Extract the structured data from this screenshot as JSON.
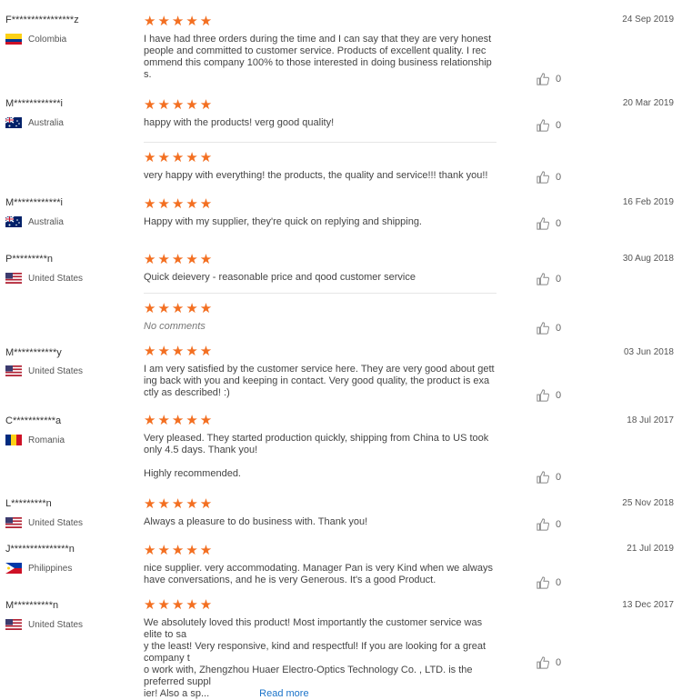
{
  "colors": {
    "star": "#f36f21",
    "link": "#1a73c9"
  },
  "stars_icon": "★★★★★",
  "reviews": [
    {
      "name": "F****************z",
      "country": "Colombia",
      "flag": "colombia",
      "date": "24 Sep 2019",
      "entries": [
        {
          "text": "I have had three orders during the time and I can say that they are very honest\npeople and committed to customer service. Products of excellent quality. I rec\nommend this company 100% to those interested in doing business relationship\ns.",
          "likes": "0"
        }
      ]
    },
    {
      "name": "M************i",
      "country": "Australia",
      "flag": "australia",
      "date": "20 Mar 2019",
      "entries": [
        {
          "text": "happy with the products! verg good quality!",
          "likes": "0"
        },
        {
          "text": "very happy with everything! the products, the quality and service!!! thank you!!",
          "likes": "0"
        }
      ]
    },
    {
      "name": "M************i",
      "country": "Australia",
      "flag": "australia",
      "date": "16 Feb 2019",
      "entries": [
        {
          "text": "Happy with my supplier, they're quick on replying and shipping.",
          "likes": "0"
        }
      ]
    },
    {
      "name": "P*********n",
      "country": "United States",
      "flag": "us",
      "date": "30 Aug 2018",
      "entries": [
        {
          "text": "Quick deievery - reasonable price and qood customer service",
          "likes": "0"
        },
        {
          "text": "No comments",
          "likes": "0"
        }
      ]
    },
    {
      "name": "M***********y",
      "country": "United States",
      "flag": "us",
      "date": "03 Jun 2018",
      "entries": [
        {
          "text": "I am very satisfied by the customer service here. They are very good about gett\ning back with you and keeping in contact. Very good quality, the product is exa\nctly as described! :)",
          "likes": "0"
        }
      ]
    },
    {
      "name": "C***********a",
      "country": "Romania",
      "flag": "romania",
      "date": "18 Jul 2017",
      "entries": [
        {
          "text": "Very pleased. They started production quickly, shipping from China to US took\nonly 4.5 days. Thank you!\n\nHighly recommended.",
          "likes": "0"
        }
      ]
    },
    {
      "name": "L*********n",
      "country": "United States",
      "flag": "us",
      "date": "25 Nov 2018",
      "entries": [
        {
          "text": "Always a pleasure to do business with. Thank you!",
          "likes": "0"
        }
      ]
    },
    {
      "name": "J***************n",
      "country": "Philippines",
      "flag": "philippines",
      "date": "21 Jul 2019",
      "entries": [
        {
          "text": "nice supplier. very accommodating. Manager Pan is very Kind when we always\nhave conversations, and he is very Generous. It's a good Product.",
          "likes": "0"
        }
      ]
    },
    {
      "name": "M**********n",
      "country": "United States",
      "flag": "us",
      "date": "13 Dec 2017",
      "entries": [
        {
          "text": "We absolutely loved this product! Most importantly the customer service was elite to sa\ny the least! Very responsive, kind and respectful! If you are looking for a great company t\no work with, Zhengzhou Huaer Electro-Optics Technology Co. , LTD. is the preferred suppl\nier! Also a sp...",
          "likes": "0",
          "read_more": "Read more"
        }
      ]
    }
  ]
}
